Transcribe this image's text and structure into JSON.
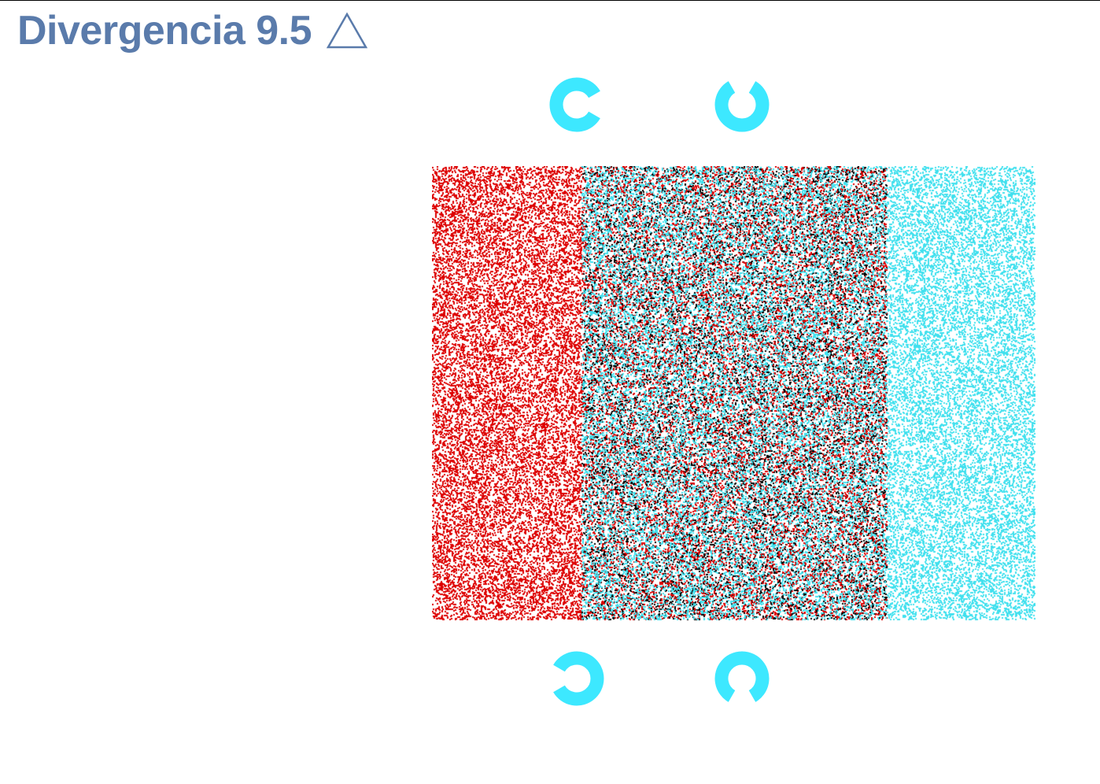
{
  "header": {
    "title": "Divergencia 9.5",
    "title_color": "#5a7bab",
    "help_icon": "triangle-outline-icon"
  },
  "stimulus": {
    "left_panel_color": "#dd0000",
    "right_panel_color": "#40e0ee",
    "center_colors": [
      "#dd0000",
      "#40e0ee",
      "#000000"
    ]
  },
  "rings": {
    "color": "#3de8ff",
    "items": [
      {
        "id": "top-left",
        "gap": "right"
      },
      {
        "id": "top-right",
        "gap": "top"
      },
      {
        "id": "bottom-left",
        "gap": "left"
      },
      {
        "id": "bottom-right",
        "gap": "bottom"
      }
    ]
  }
}
